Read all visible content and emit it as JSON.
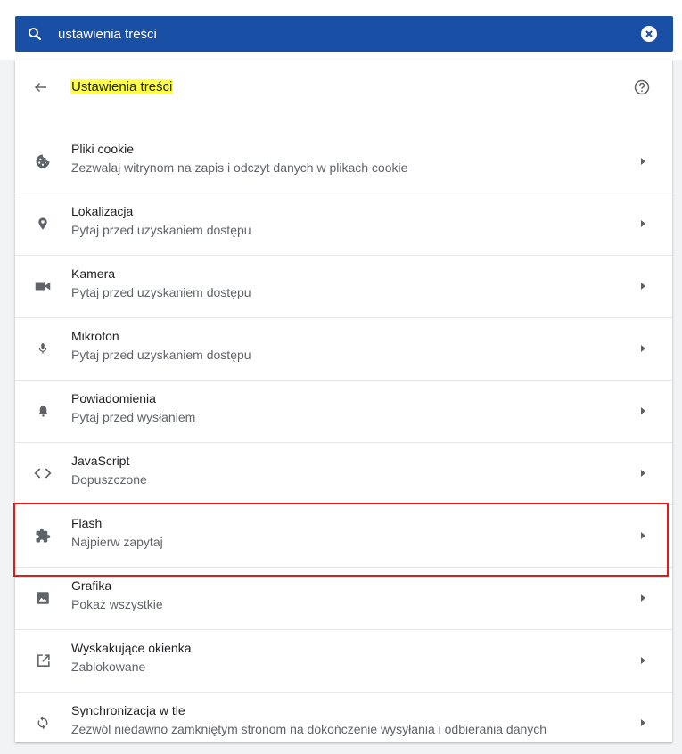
{
  "search": {
    "query": "ustawienia treści",
    "icon": "search-icon",
    "clear_icon": "clear-icon"
  },
  "header": {
    "title": "Ustawienia treści",
    "back_icon": "arrow-back-icon",
    "help_icon": "help-icon"
  },
  "items": [
    {
      "label": "Pliki cookie",
      "sub": "Zezwalaj witrynom na zapis i odczyt danych w plikach cookie",
      "icon": "cookie-icon"
    },
    {
      "label": "Lokalizacja",
      "sub": "Pytaj przed uzyskaniem dostępu",
      "icon": "location-pin-icon"
    },
    {
      "label": "Kamera",
      "sub": "Pytaj przed uzyskaniem dostępu",
      "icon": "camera-icon"
    },
    {
      "label": "Mikrofon",
      "sub": "Pytaj przed uzyskaniem dostępu",
      "icon": "microphone-icon"
    },
    {
      "label": "Powiadomienia",
      "sub": "Pytaj przed wysłaniem",
      "icon": "bell-icon"
    },
    {
      "label": "JavaScript",
      "sub": "Dopuszczone",
      "icon": "code-icon"
    },
    {
      "label": "Flash",
      "sub": "Najpierw zapytaj",
      "icon": "puzzle-icon"
    },
    {
      "label": "Grafika",
      "sub": "Pokaż wszystkie",
      "icon": "image-icon"
    },
    {
      "label": "Wyskakujące okienka",
      "sub": "Zablokowane",
      "icon": "open-in-new-icon"
    },
    {
      "label": "Synchronizacja w tle",
      "sub": "Zezwól niedawno zamkniętym stronom na dokończenie wysyłania i odbierania danych",
      "icon": "sync-icon"
    }
  ],
  "colors": {
    "search_bg": "#1a4fa6",
    "highlight_text": "#ffff45",
    "annotation_box": "#e11a1a"
  }
}
